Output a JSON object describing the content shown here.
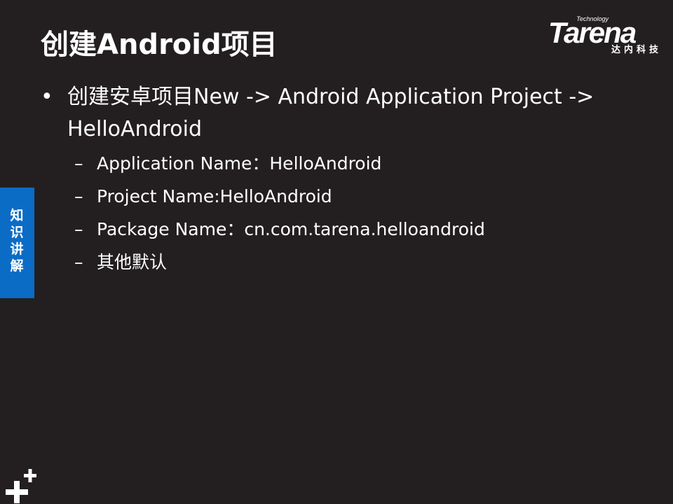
{
  "slide": {
    "title": "创建Android项目",
    "side_tab": "知识讲解",
    "bullet": {
      "mark": "•",
      "text": "创建安卓项目New -> Android Application Project -> HelloAndroid"
    },
    "sub_mark": "–",
    "sub_bullets": [
      "Application Name：HelloAndroid",
      "Project Name:HelloAndroid",
      "Package Name：cn.com.tarena.helloandroid",
      "其他默认"
    ]
  },
  "logo": {
    "technology": "Technology",
    "name": "Tarena",
    "cn": "达内科技"
  },
  "icons": {
    "corner": "plus-plus-icon"
  },
  "colors": {
    "background": "#231f20",
    "text": "#ffffff",
    "accent_blue": "#0b6cc6"
  }
}
